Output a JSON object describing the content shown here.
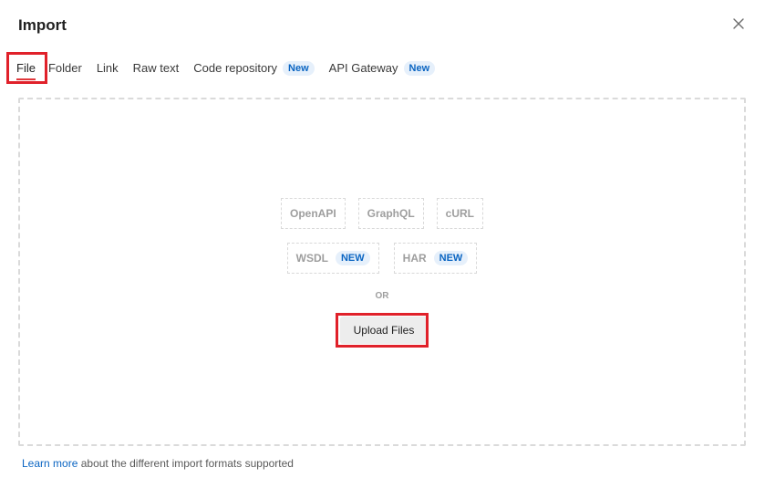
{
  "dialog": {
    "title": "Import"
  },
  "tabs": [
    {
      "label": "File",
      "active": true
    },
    {
      "label": "Folder"
    },
    {
      "label": "Link"
    },
    {
      "label": "Raw text"
    },
    {
      "label": "Code repository",
      "badge": "New"
    },
    {
      "label": "API Gateway",
      "badge": "New"
    }
  ],
  "formats": {
    "row1": [
      "OpenAPI",
      "GraphQL",
      "cURL"
    ],
    "row2": [
      {
        "label": "WSDL",
        "badge": "NEW"
      },
      {
        "label": "HAR",
        "badge": "NEW"
      }
    ]
  },
  "dropzone": {
    "or_text": "OR",
    "upload_label": "Upload Files"
  },
  "footer": {
    "link_text": "Learn more",
    "text": "about the different import formats supported"
  },
  "colors": {
    "highlight": "#e0212a",
    "link": "#0b65c2",
    "badge_bg": "#e6f0fb"
  }
}
